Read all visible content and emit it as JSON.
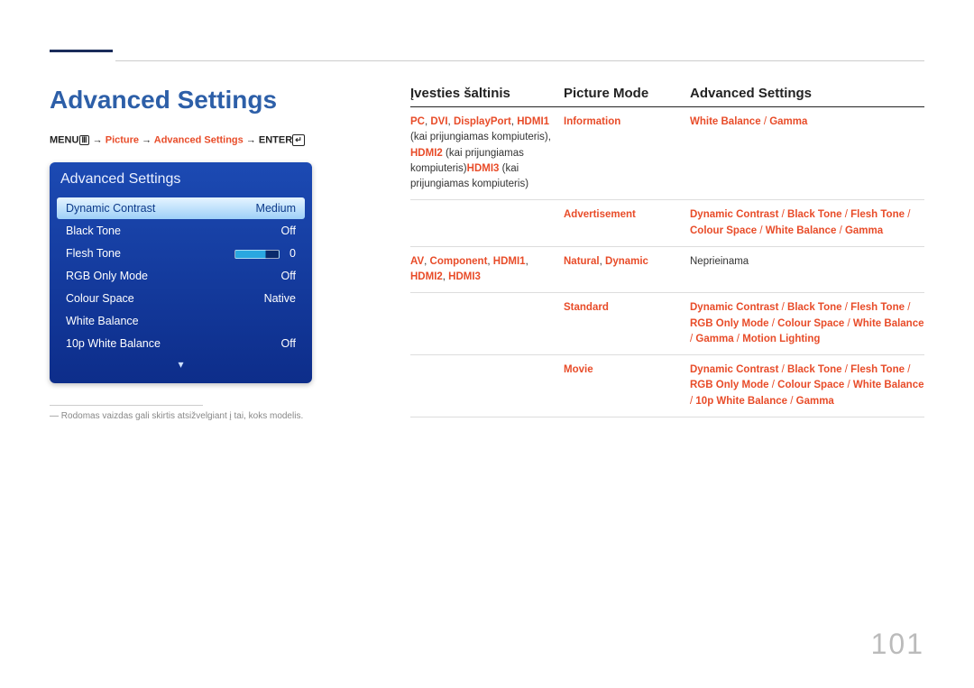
{
  "page_title": "Advanced Settings",
  "breadcrumb": {
    "menu": "MENU",
    "arrow": "→",
    "picture": "Picture",
    "advanced": "Advanced Settings",
    "enter": "ENTER"
  },
  "osd": {
    "title": "Advanced Settings",
    "rows": [
      {
        "label": "Dynamic Contrast",
        "value": "Medium",
        "selected": true
      },
      {
        "label": "Black Tone",
        "value": "Off"
      },
      {
        "label": "Flesh Tone",
        "value": "0",
        "slider": true
      },
      {
        "label": "RGB Only Mode",
        "value": "Off"
      },
      {
        "label": "Colour Space",
        "value": "Native"
      },
      {
        "label": "White Balance",
        "value": ""
      },
      {
        "label": "10p White Balance",
        "value": "Off"
      }
    ]
  },
  "footnote": "Rodomas vaizdas gali skirtis atsižvelgiant į tai, koks modelis.",
  "table": {
    "headers": {
      "c1": "Įvesties šaltinis",
      "c2": "Picture Mode",
      "c3": "Advanced Settings"
    },
    "rows": [
      {
        "c1_html": "<span class='hl'>PC</span>, <span class='hl'>DVI</span>, <span class='hl'>DisplayPort</span>, <span class='hl'>HDMI1</span> <span class='plain'>(kai prijungiamas kompiuteris),</span> <span class='hl'>HDMI2</span> <span class='plain'>(kai prijungiamas kompiuteris)</span><span class='hl'>HDMI3</span> <span class='plain'>(kai prijungiamas kompiuteris)</span>",
        "sub": [
          {
            "c2": "<span class='hl'>Information</span>",
            "c3": "<span class='hl'>White Balance</span> <span class='sep'>/</span> <span class='hl'>Gamma</span>"
          },
          {
            "c2": "<span class='hl'>Advertisement</span>",
            "c3": "<span class='hl'>Dynamic Contrast</span> <span class='sep'>/</span> <span class='hl'>Black Tone</span> <span class='sep'>/</span> <span class='hl'>Flesh Tone</span> <span class='sep'>/</span> <span class='hl'>Colour Space</span> <span class='sep'>/</span> <span class='hl'>White Balance</span> <span class='sep'>/</span> <span class='hl'>Gamma</span>"
          }
        ]
      },
      {
        "c1_html": "<span class='hl'>AV</span>, <span class='hl'>Component</span>, <span class='hl'>HDMI1</span>, <span class='hl'>HDMI2</span>, <span class='hl'>HDMI3</span>",
        "sub": [
          {
            "c2": "<span class='hl'>Natural</span>, <span class='hl'>Dynamic</span>",
            "c3": "<span class='plain'>Neprieinama</span>"
          },
          {
            "c2": "<span class='hl'>Standard</span>",
            "c3": "<span class='hl'>Dynamic Contrast</span> <span class='sep'>/</span> <span class='hl'>Black Tone</span> <span class='sep'>/</span> <span class='hl'>Flesh Tone</span> <span class='sep'>/</span> <span class='hl'>RGB Only Mode</span> <span class='sep'>/</span> <span class='hl'>Colour Space</span> <span class='sep'>/</span> <span class='hl'>White Balance</span> <span class='sep'>/</span> <span class='hl'>Gamma</span> <span class='sep'>/</span> <span class='hl'>Motion Lighting</span>"
          },
          {
            "c2": "<span class='hl'>Movie</span>",
            "c3": "<span class='hl'>Dynamic Contrast</span> <span class='sep'>/</span> <span class='hl'>Black Tone</span> <span class='sep'>/</span> <span class='hl'>Flesh Tone</span> <span class='sep'>/</span> <span class='hl'>RGB Only Mode</span> <span class='sep'>/</span> <span class='hl'>Colour Space</span> <span class='sep'>/</span> <span class='hl'>White Balance</span> <span class='sep'>/</span> <span class='hl'>10p White Balance</span> <span class='sep'>/</span> <span class='hl'>Gamma</span>"
          }
        ]
      }
    ]
  },
  "page_number": "101"
}
